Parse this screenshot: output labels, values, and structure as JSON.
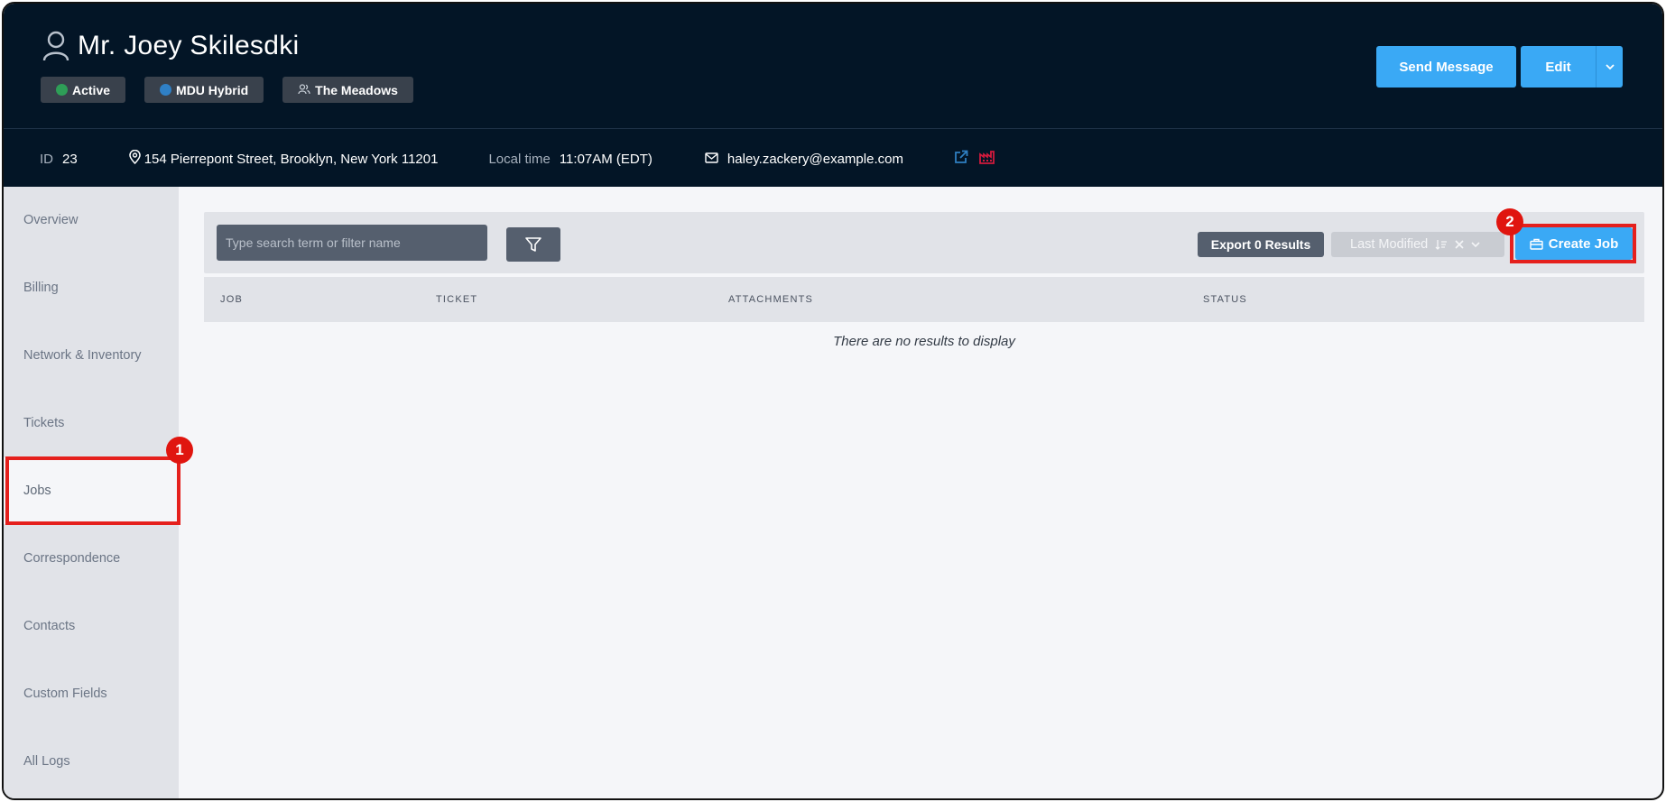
{
  "profile": {
    "name": "Mr. Joey Skilesdki",
    "badges": [
      {
        "label": "Active",
        "dot_color": "#2e9e57"
      },
      {
        "label": "MDU Hybrid",
        "dot_color": "#2f80c6"
      },
      {
        "label": "The Meadows",
        "icon": "people-icon"
      }
    ]
  },
  "header_actions": {
    "send_message": "Send Message",
    "edit": "Edit"
  },
  "info": {
    "id_label": "ID",
    "id_value": "23",
    "address": "154 Pierrepont Street, Brooklyn, New York 11201",
    "local_time_label": "Local time",
    "local_time_value": "11:07AM (EDT)",
    "email": "haley.zackery@example.com"
  },
  "sidebar": {
    "items": [
      {
        "label": "Overview"
      },
      {
        "label": "Billing"
      },
      {
        "label": "Network & Inventory"
      },
      {
        "label": "Tickets"
      },
      {
        "label": "Jobs",
        "active": true
      },
      {
        "label": "Correspondence"
      },
      {
        "label": "Contacts"
      },
      {
        "label": "Custom Fields"
      },
      {
        "label": "All Logs"
      }
    ]
  },
  "toolbar": {
    "search_placeholder": "Type search term or filter name",
    "export_label": "Export 0 Results",
    "sort_label": "Last Modified",
    "create_label": "Create Job"
  },
  "table": {
    "columns": [
      "JOB",
      "TICKET",
      "ATTACHMENTS",
      "STATUS"
    ],
    "empty_message": "There are no results to display"
  },
  "annotations": {
    "marker_1": "1",
    "marker_2": "2"
  },
  "colors": {
    "header_bg": "#031526",
    "accent": "#3aa9f5",
    "highlight": "#e5201d"
  }
}
